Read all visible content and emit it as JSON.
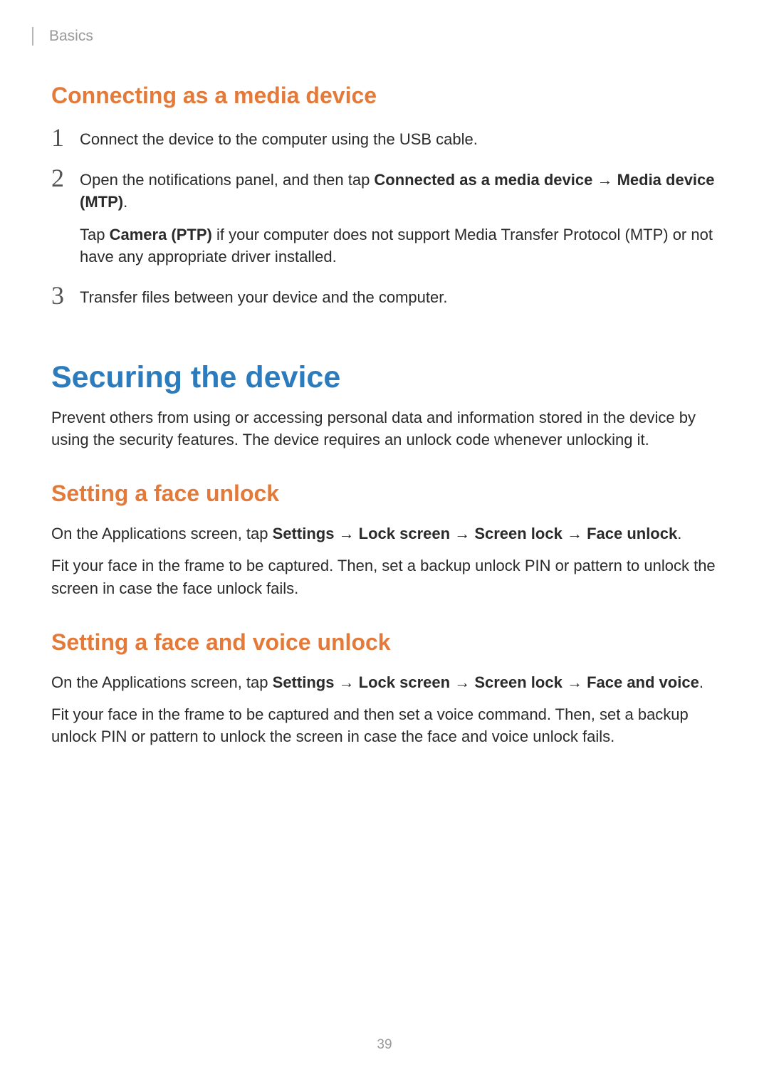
{
  "header": {
    "label": "Basics"
  },
  "section1": {
    "heading": "Connecting as a media device",
    "steps": {
      "s1": {
        "num": "1",
        "text": "Connect the device to the computer using the USB cable."
      },
      "s2": {
        "num": "2",
        "line1_a": "Open the notifications panel, and then tap ",
        "line1_b": "Connected as a media device",
        "line1_arrow": " → ",
        "line1_c": "Media device (MTP)",
        "line1_d": ".",
        "line2_a": "Tap ",
        "line2_b": "Camera (PTP)",
        "line2_c": " if your computer does not support Media Transfer Protocol (MTP) or not have any appropriate driver installed."
      },
      "s3": {
        "num": "3",
        "text": "Transfer files between your device and the computer."
      }
    }
  },
  "main": {
    "heading": "Securing the device",
    "intro": "Prevent others from using or accessing personal data and information stored in the device by using the security features. The device requires an unlock code whenever unlocking it."
  },
  "sub1": {
    "heading": "Setting a face unlock",
    "p1_a": "On the Applications screen, tap ",
    "p1_b": "Settings",
    "p1_arr1": " → ",
    "p1_c": "Lock screen",
    "p1_arr2": " → ",
    "p1_d": "Screen lock",
    "p1_arr3": " → ",
    "p1_e": "Face unlock",
    "p1_f": ".",
    "p2": "Fit your face in the frame to be captured. Then, set a backup unlock PIN or pattern to unlock the screen in case the face unlock fails."
  },
  "sub2": {
    "heading": "Setting a face and voice unlock",
    "p1_a": "On the Applications screen, tap ",
    "p1_b": "Settings",
    "p1_arr1": " → ",
    "p1_c": "Lock screen",
    "p1_arr2": " → ",
    "p1_d": "Screen lock",
    "p1_arr3": " → ",
    "p1_e": "Face and voice",
    "p1_f": ".",
    "p2": "Fit your face in the frame to be captured and then set a voice command. Then, set a backup unlock PIN or pattern to unlock the screen in case the face and voice unlock fails."
  },
  "page_number": "39"
}
